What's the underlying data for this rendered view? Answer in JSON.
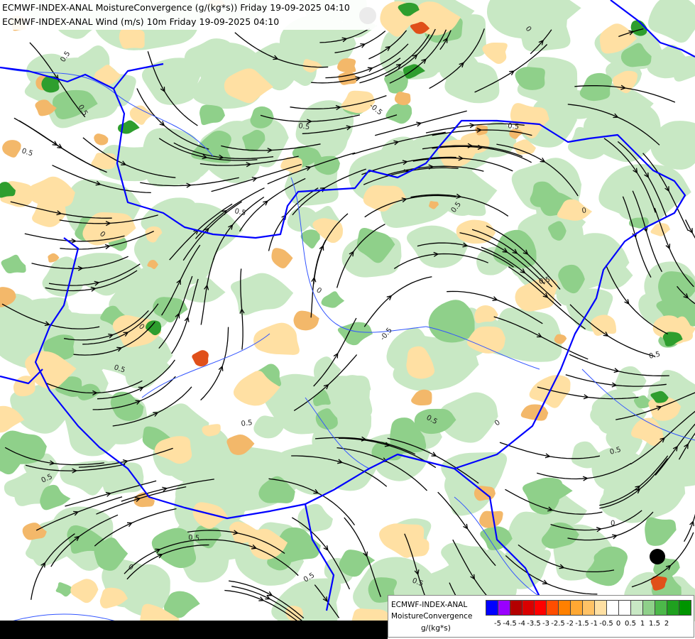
{
  "title": {
    "line1": "ECMWF-INDEX-ANAL MoistureConvergence (g/(kg*s)) Friday 19-09-2025 04:10",
    "line2": "ECMWF-INDEX-ANAL Wind (m/s) 10m Friday 19-09-2025 04:10"
  },
  "legend": {
    "title1": "ECMWF-INDEX-ANAL",
    "title2": "MoistureConvergence",
    "units": "g/(kg*s)",
    "colors": [
      "#0000ff",
      "#9900ff",
      "#b30000",
      "#d90000",
      "#ff0000",
      "#ff4d00",
      "#ff8000",
      "#ffa833",
      "#ffc266",
      "#ffe0a3",
      "#ffffff",
      "#ffffff",
      "#c8e8c4",
      "#8fd08a",
      "#4cb84a",
      "#1fa01f",
      "#009400"
    ],
    "ticks": [
      "-5",
      "-4.5",
      "-4",
      "-3.5",
      "-3",
      "-2.5",
      "-2",
      "-1.5",
      "-1",
      "-0.5",
      "0",
      "0.5",
      "1",
      "1.5",
      "2"
    ]
  },
  "contour_labels": [
    "0.5",
    "0",
    "0.5",
    "0",
    "-0.5",
    "0.5",
    "0",
    "0.5",
    "0.5",
    "0",
    "0.5",
    "0",
    "0.5",
    "0.5",
    "0",
    "0.5",
    "-0.5",
    "0.5",
    "0",
    "0.5",
    "0.5",
    "0.5",
    "0",
    "0.5",
    "0.5",
    "0.5",
    "0.5"
  ],
  "map_colors": {
    "border": "#0000ff",
    "river": "#3355ff",
    "streamline": "#000000",
    "conv_light": "#c8e8c4",
    "conv_mid": "#8fd08a",
    "conv_strong": "#2e9e2e",
    "div_light": "#ffe0a3",
    "div_mid": "#f3b86a",
    "div_strong": "#e0501a"
  }
}
